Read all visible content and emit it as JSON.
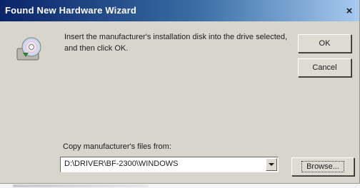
{
  "window": {
    "title": "Found New Hardware Wizard",
    "close_glyph": "×"
  },
  "message": "Insert the manufacturer's installation disk into the drive selected, and then click OK.",
  "buttons": {
    "ok": "OK",
    "cancel": "Cancel",
    "browse": "Browse..."
  },
  "copy_from": {
    "label": "Copy manufacturer's files from:",
    "value": "D:\\DRIVER\\BF-2300\\WINDOWS"
  },
  "icons": {
    "disk": "cd-disk-icon",
    "dropdown": "chevron-down-icon"
  },
  "colors": {
    "titlebar_start": "#0a246a",
    "titlebar_end": "#a6caf0",
    "dialog_face": "#d8d5cc"
  }
}
